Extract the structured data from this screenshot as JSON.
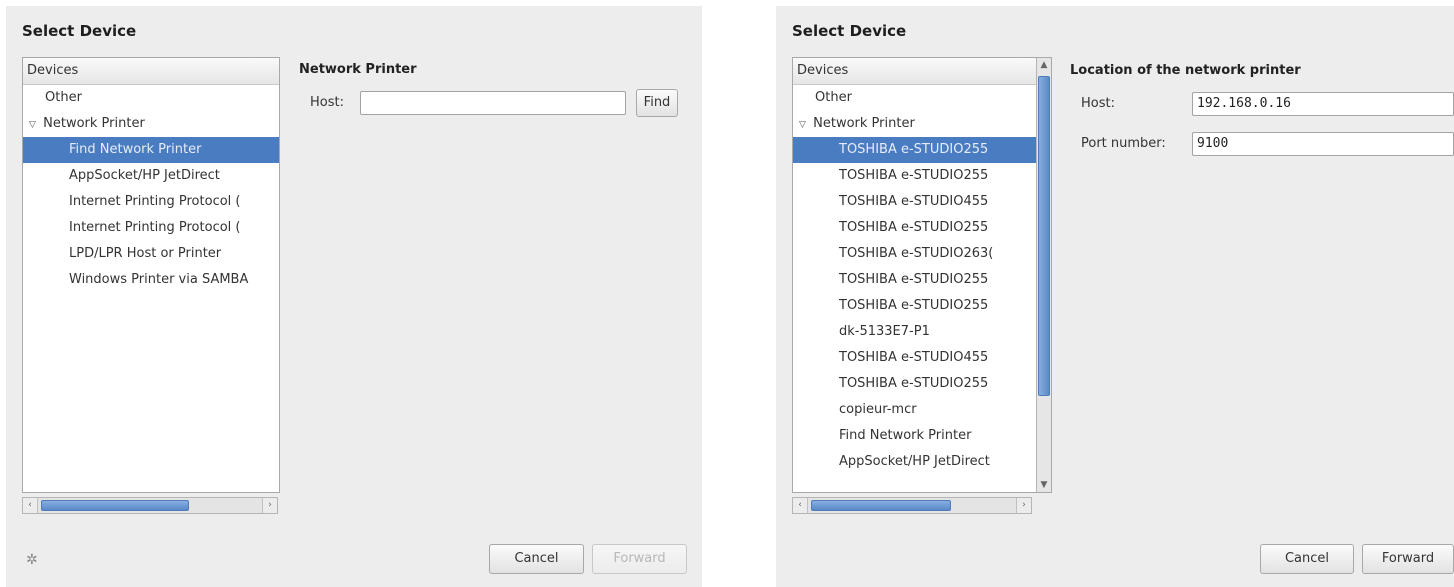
{
  "left": {
    "title": "Select Device",
    "devices_header": "Devices",
    "tree": [
      {
        "label": "Other",
        "selected": false,
        "expander": ""
      },
      {
        "label": "Network Printer",
        "selected": false,
        "expander": "▽"
      },
      {
        "label": "Find Network Printer",
        "selected": true,
        "expander": ""
      },
      {
        "label": "AppSocket/HP JetDirect",
        "selected": false,
        "expander": ""
      },
      {
        "label": "Internet Printing Protocol (",
        "selected": false,
        "expander": ""
      },
      {
        "label": "Internet Printing Protocol (",
        "selected": false,
        "expander": ""
      },
      {
        "label": "LPD/LPR Host or Printer",
        "selected": false,
        "expander": ""
      },
      {
        "label": "Windows Printer via SAMBA",
        "selected": false,
        "expander": ""
      }
    ],
    "section_title": "Network Printer",
    "host_label": "Host:",
    "host_value": "",
    "find_label": "Find",
    "cancel_label": "Cancel",
    "forward_label": "Forward",
    "spinner_icon": "spinner-icon"
  },
  "right": {
    "title": "Select Device",
    "devices_header": "Devices",
    "tree": [
      {
        "label": "Other",
        "selected": false,
        "expander": ""
      },
      {
        "label": "Network Printer",
        "selected": false,
        "expander": "▽"
      },
      {
        "label": "TOSHIBA e-STUDIO255",
        "selected": true,
        "expander": ""
      },
      {
        "label": "TOSHIBA e-STUDIO255",
        "selected": false,
        "expander": ""
      },
      {
        "label": "TOSHIBA e-STUDIO455",
        "selected": false,
        "expander": ""
      },
      {
        "label": "TOSHIBA e-STUDIO255",
        "selected": false,
        "expander": ""
      },
      {
        "label": "TOSHIBA e-STUDIO263(",
        "selected": false,
        "expander": ""
      },
      {
        "label": "TOSHIBA e-STUDIO255",
        "selected": false,
        "expander": ""
      },
      {
        "label": "TOSHIBA e-STUDIO255",
        "selected": false,
        "expander": ""
      },
      {
        "label": "dk-5133E7-P1",
        "selected": false,
        "expander": ""
      },
      {
        "label": "TOSHIBA e-STUDIO455",
        "selected": false,
        "expander": ""
      },
      {
        "label": "TOSHIBA e-STUDIO255",
        "selected": false,
        "expander": ""
      },
      {
        "label": "copieur-mcr",
        "selected": false,
        "expander": ""
      },
      {
        "label": "Find Network Printer",
        "selected": false,
        "expander": ""
      },
      {
        "label": "AppSocket/HP JetDirect",
        "selected": false,
        "expander": ""
      }
    ],
    "section_title": "Location of the network printer",
    "host_label": "Host:",
    "host_value": "192.168.0.16",
    "port_label": "Port number:",
    "port_value": "9100",
    "cancel_label": "Cancel",
    "forward_label": "Forward"
  },
  "colors": {
    "selection": "#4a7cc2",
    "panel": "#ededed",
    "scroll_thumb": "#5b89c8"
  }
}
